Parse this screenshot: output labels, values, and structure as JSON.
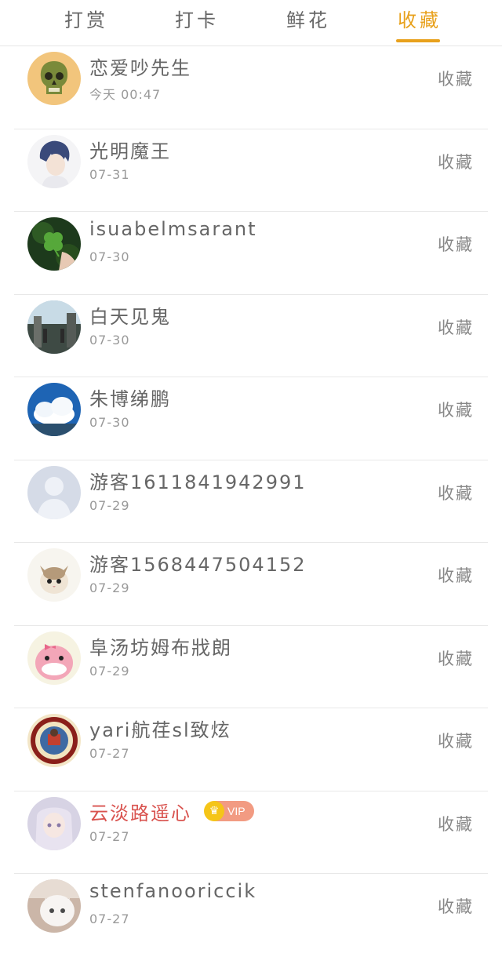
{
  "tabs": [
    {
      "label": "打赏"
    },
    {
      "label": "打卡"
    },
    {
      "label": "鲜花"
    },
    {
      "label": "收藏",
      "active": true
    }
  ],
  "accent_color": "#e8a11c",
  "items": [
    {
      "name": "恋爱吵先生",
      "time": "今天 00:47",
      "action": "收藏",
      "avatar": "skull-avatar"
    },
    {
      "name": "光明魔王",
      "time": "07-31",
      "action": "收藏",
      "avatar": "anime-boy-avatar"
    },
    {
      "name": "isuabelmsarant",
      "time": "07-30",
      "action": "收藏",
      "avatar": "clover-avatar"
    },
    {
      "name": "白天见鬼",
      "time": "07-30",
      "action": "收藏",
      "avatar": "scenery-avatar"
    },
    {
      "name": "朱博绨鹏",
      "time": "07-30",
      "action": "收藏",
      "avatar": "sky-avatar"
    },
    {
      "name": "游客1611841942991",
      "time": "07-29",
      "action": "收藏",
      "avatar": "default-user-avatar"
    },
    {
      "name": "游客1568447504152",
      "time": "07-29",
      "action": "收藏",
      "avatar": "cat-avatar"
    },
    {
      "name": "阜汤坊姆布戕朗",
      "time": "07-29",
      "action": "收藏",
      "avatar": "pink-pig-avatar"
    },
    {
      "name": "yari航荏sl致炫",
      "time": "07-27",
      "action": "收藏",
      "avatar": "badge-avatar"
    },
    {
      "name": "云淡路遥心",
      "time": "07-27",
      "action": "收藏",
      "avatar": "anime-girl-avatar",
      "vip": "VIP"
    },
    {
      "name": "stenfanooriccik",
      "time": "07-27",
      "action": "收藏",
      "avatar": "white-cat-avatar"
    }
  ]
}
